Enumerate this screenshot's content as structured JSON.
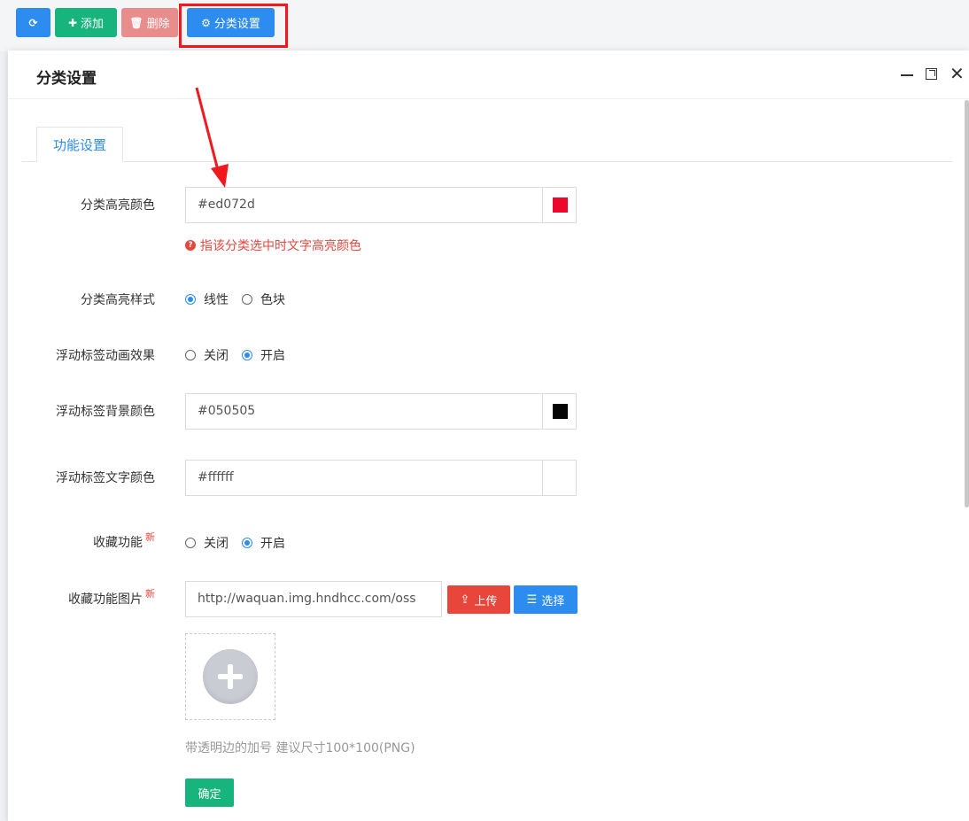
{
  "toolbar": {
    "refresh_icon": "refresh-icon",
    "add_label": "添加",
    "delete_label": "删除",
    "category_settings_label": "分类设置"
  },
  "modal": {
    "title": "分类设置",
    "tab_label": "功能设置"
  },
  "form": {
    "highlight_color": {
      "label": "分类高亮颜色",
      "value": "#ed072d",
      "swatch": "#ed072d",
      "hint": "指该分类选中时文字高亮颜色"
    },
    "highlight_style": {
      "label": "分类高亮样式",
      "options": [
        "线性",
        "色块"
      ],
      "selected": "线性"
    },
    "float_anim": {
      "label": "浮动标签动画效果",
      "options": [
        "关闭",
        "开启"
      ],
      "selected": "开启"
    },
    "float_bg_color": {
      "label": "浮动标签背景颜色",
      "value": "#050505",
      "swatch": "#050505"
    },
    "float_text_color": {
      "label": "浮动标签文字颜色",
      "value": "#ffffff",
      "swatch": "#ffffff"
    },
    "favorite": {
      "label": "收藏功能",
      "badge": "新",
      "options": [
        "关闭",
        "开启"
      ],
      "selected": "开启"
    },
    "favorite_image": {
      "label": "收藏功能图片",
      "badge": "新",
      "value": "http://waquan.img.hndhcc.com/oss",
      "upload_label": "上传",
      "choose_label": "选择",
      "note": "带透明边的加号 建议尺寸100*100(PNG)"
    },
    "confirm_label": "确定"
  },
  "colors": {
    "primary": "#2d8cf0",
    "success": "#18b47e",
    "danger": "#e8463b",
    "annotation": "#f0191e"
  }
}
